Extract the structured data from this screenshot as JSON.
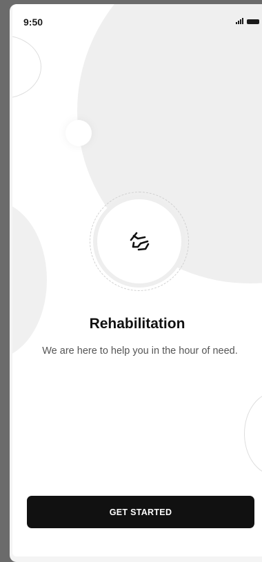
{
  "status_bar": {
    "time": "9:50",
    "signal_icon": "signal-bars-icon",
    "battery_icon": "battery-icon"
  },
  "onboarding": {
    "icon": "helping-hand-icon",
    "title": "Rehabilitation",
    "subtitle": "We are here to help you in the hour of need."
  },
  "cta": {
    "label": "GET STARTED"
  },
  "colors": {
    "primary": "#111111",
    "background": "#ffffff",
    "decor": "#efefef"
  }
}
